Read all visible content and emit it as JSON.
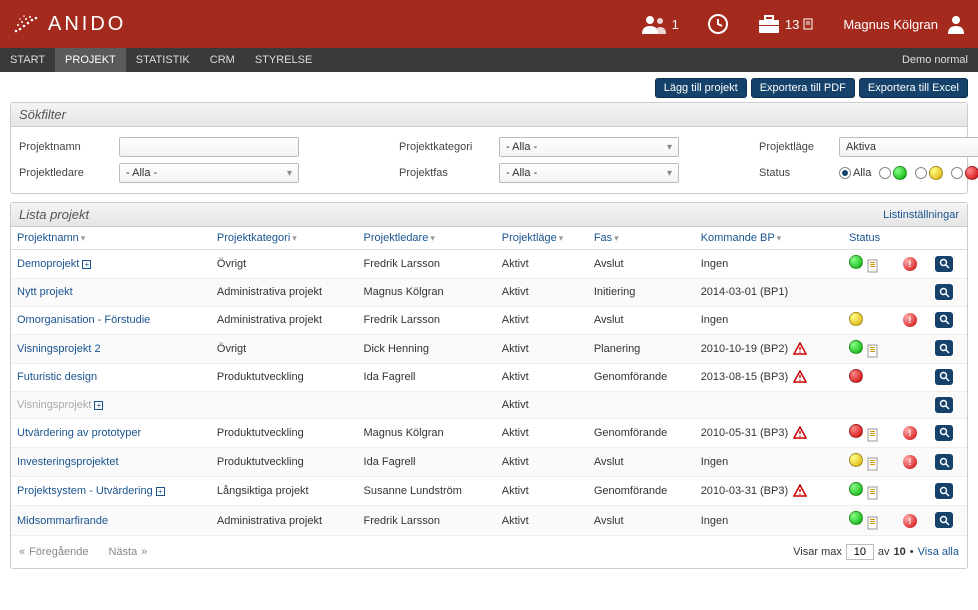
{
  "header": {
    "logo": "ANIDO",
    "users_count": "1",
    "briefcase_count": "13",
    "user_name": "Magnus Kölgran"
  },
  "nav": {
    "items": [
      "START",
      "PROJEKT",
      "STATISTIK",
      "CRM",
      "STYRELSE"
    ],
    "active_index": 1,
    "right_label": "Demo normal"
  },
  "toolbar": {
    "add_label": "Lägg till projekt",
    "pdf_label": "Exportera till PDF",
    "excel_label": "Exportera till Excel"
  },
  "filter_panel": {
    "title": "Sökfilter",
    "projektnamn_label": "Projektnamn",
    "projektnamn_value": "",
    "projektledare_label": "Projektledare",
    "projektledare_value": "- Alla -",
    "projektkategori_label": "Projektkategori",
    "projektkategori_value": "- Alla -",
    "projektfas_label": "Projektfas",
    "projektfas_value": "- Alla -",
    "projektlage_label": "Projektläge",
    "projektlage_value": "Aktiva",
    "status_label": "Status",
    "status_all_label": "Alla"
  },
  "list_panel": {
    "title": "Lista projekt",
    "settings_label": "Listinställningar",
    "columns": {
      "name": "Projektnamn",
      "category": "Projektkategori",
      "leader": "Projektledare",
      "mode": "Projektläge",
      "phase": "Fas",
      "bp": "Kommande BP",
      "status": "Status"
    },
    "rows": [
      {
        "name": "Demoprojekt",
        "expand": true,
        "category": "Övrigt",
        "leader": "Fredrik Larsson",
        "mode": "Aktivt",
        "phase": "Avslut",
        "bp": "Ingen",
        "bp_warn": false,
        "status_dot": "green",
        "status_doc": true,
        "alert": true
      },
      {
        "name": "Nytt projekt",
        "expand": false,
        "category": "Administrativa projekt",
        "leader": "Magnus Kölgran",
        "mode": "Aktivt",
        "phase": "Initiering",
        "bp": "2014-03-01 (BP1)",
        "bp_warn": false,
        "status_dot": "",
        "status_doc": false,
        "alert": false
      },
      {
        "name": "Omorganisation - Förstudie",
        "expand": false,
        "category": "Administrativa projekt",
        "leader": "Fredrik Larsson",
        "mode": "Aktivt",
        "phase": "Avslut",
        "bp": "Ingen",
        "bp_warn": false,
        "status_dot": "yellow",
        "status_doc": false,
        "alert": true
      },
      {
        "name": "Visningsprojekt 2",
        "expand": false,
        "category": "Övrigt",
        "leader": "Dick Henning",
        "mode": "Aktivt",
        "phase": "Planering",
        "bp": "2010-10-19 (BP2)",
        "bp_warn": true,
        "status_dot": "green",
        "status_doc": true,
        "alert": false
      },
      {
        "name": "Futuristic design",
        "expand": false,
        "category": "Produktutveckling",
        "leader": "Ida Fagrell",
        "mode": "Aktivt",
        "phase": "Genomförande",
        "bp": "2013-08-15 (BP3)",
        "bp_warn": true,
        "status_dot": "red",
        "status_doc": false,
        "alert": false
      },
      {
        "name": "Visningsprojekt",
        "expand": true,
        "muted": true,
        "category": "",
        "leader": "",
        "mode": "Aktivt",
        "phase": "",
        "bp": "",
        "bp_warn": false,
        "status_dot": "",
        "status_doc": false,
        "alert": false
      },
      {
        "name": "Utvärdering av prototyper",
        "expand": false,
        "category": "Produktutveckling",
        "leader": "Magnus Kölgran",
        "mode": "Aktivt",
        "phase": "Genomförande",
        "bp": "2010-05-31 (BP3)",
        "bp_warn": true,
        "status_dot": "red",
        "status_doc": true,
        "alert": true
      },
      {
        "name": "Investeringsprojektet",
        "expand": false,
        "category": "Produktutveckling",
        "leader": "Ida Fagrell",
        "mode": "Aktivt",
        "phase": "Avslut",
        "bp": "Ingen",
        "bp_warn": false,
        "status_dot": "yellow",
        "status_doc": true,
        "alert": true
      },
      {
        "name": "Projektsystem - Utvärdering",
        "expand": true,
        "category": "Långsiktiga projekt",
        "leader": "Susanne Lundström",
        "mode": "Aktivt",
        "phase": "Genomförande",
        "bp": "2010-03-31 (BP3)",
        "bp_warn": true,
        "status_dot": "green",
        "status_doc": true,
        "alert": false
      },
      {
        "name": "Midsommarfirande",
        "expand": false,
        "category": "Administrativa projekt",
        "leader": "Fredrik Larsson",
        "mode": "Aktivt",
        "phase": "Avslut",
        "bp": "Ingen",
        "bp_warn": false,
        "status_dot": "green",
        "status_doc": true,
        "alert": true
      }
    ]
  },
  "pager": {
    "prev": "Föregående",
    "next": "Nästa",
    "showing_prefix": "Visar max",
    "max_value": "10",
    "of_label": "av",
    "total": "10",
    "show_all": "Visa alla"
  }
}
